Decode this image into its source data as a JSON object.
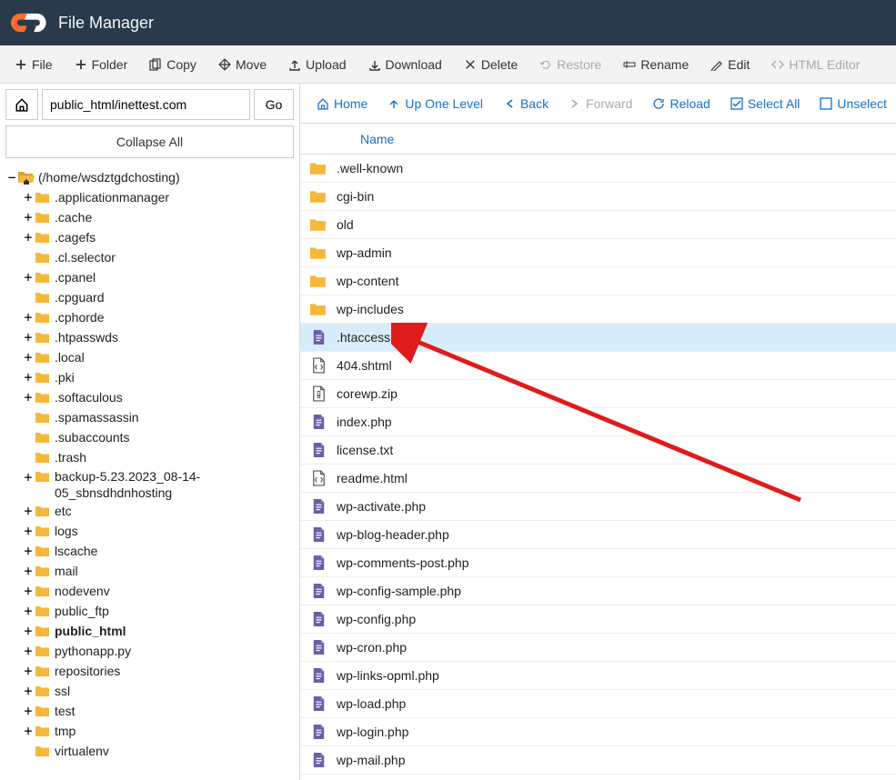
{
  "header": {
    "title": "File Manager"
  },
  "toolbar": {
    "file": "File",
    "folder": "Folder",
    "copy": "Copy",
    "move": "Move",
    "upload": "Upload",
    "download": "Download",
    "delete": "Delete",
    "restore": "Restore",
    "rename": "Rename",
    "edit": "Edit",
    "html_editor": "HTML Editor"
  },
  "path_bar": {
    "path": "public_html/inettest.com",
    "go": "Go"
  },
  "collapse": "Collapse All",
  "tree": {
    "root": "(/home/wsdztgdchosting)",
    "items": [
      {
        "label": ".applicationmanager",
        "expandable": true
      },
      {
        "label": ".cache",
        "expandable": true
      },
      {
        "label": ".cagefs",
        "expandable": true
      },
      {
        "label": ".cl.selector",
        "expandable": false
      },
      {
        "label": ".cpanel",
        "expandable": true
      },
      {
        "label": ".cpguard",
        "expandable": false
      },
      {
        "label": ".cphorde",
        "expandable": true
      },
      {
        "label": ".htpasswds",
        "expandable": true
      },
      {
        "label": ".local",
        "expandable": true
      },
      {
        "label": ".pki",
        "expandable": true
      },
      {
        "label": ".softaculous",
        "expandable": true
      },
      {
        "label": ".spamassassin",
        "expandable": false
      },
      {
        "label": ".subaccounts",
        "expandable": false
      },
      {
        "label": ".trash",
        "expandable": false
      },
      {
        "label": "backup-5.23.2023_08-14-05_sbnsdhdnhosting",
        "expandable": true,
        "wrap": true
      },
      {
        "label": "etc",
        "expandable": true
      },
      {
        "label": "logs",
        "expandable": true
      },
      {
        "label": "lscache",
        "expandable": true
      },
      {
        "label": "mail",
        "expandable": true
      },
      {
        "label": "nodevenv",
        "expandable": true
      },
      {
        "label": "public_ftp",
        "expandable": true
      },
      {
        "label": "public_html",
        "expandable": true,
        "bold": true
      },
      {
        "label": "pythonapp.py",
        "expandable": true
      },
      {
        "label": "repositories",
        "expandable": true
      },
      {
        "label": "ssl",
        "expandable": true
      },
      {
        "label": "test",
        "expandable": true
      },
      {
        "label": "tmp",
        "expandable": true
      },
      {
        "label": "virtualenv",
        "expandable": false
      }
    ]
  },
  "actions": {
    "home": "Home",
    "up": "Up One Level",
    "back": "Back",
    "forward": "Forward",
    "reload": "Reload",
    "select_all": "Select All",
    "unselect": "Unselect"
  },
  "table": {
    "name_header": "Name"
  },
  "files": [
    {
      "name": ".well-known",
      "type": "folder"
    },
    {
      "name": "cgi-bin",
      "type": "folder"
    },
    {
      "name": "old",
      "type": "folder"
    },
    {
      "name": "wp-admin",
      "type": "folder"
    },
    {
      "name": "wp-content",
      "type": "folder"
    },
    {
      "name": "wp-includes",
      "type": "folder"
    },
    {
      "name": ".htaccess",
      "type": "file",
      "selected": true
    },
    {
      "name": "404.shtml",
      "type": "html"
    },
    {
      "name": "corewp.zip",
      "type": "zip"
    },
    {
      "name": "index.php",
      "type": "file"
    },
    {
      "name": "license.txt",
      "type": "file"
    },
    {
      "name": "readme.html",
      "type": "html"
    },
    {
      "name": "wp-activate.php",
      "type": "file"
    },
    {
      "name": "wp-blog-header.php",
      "type": "file"
    },
    {
      "name": "wp-comments-post.php",
      "type": "file"
    },
    {
      "name": "wp-config-sample.php",
      "type": "file"
    },
    {
      "name": "wp-config.php",
      "type": "file"
    },
    {
      "name": "wp-cron.php",
      "type": "file"
    },
    {
      "name": "wp-links-opml.php",
      "type": "file"
    },
    {
      "name": "wp-load.php",
      "type": "file"
    },
    {
      "name": "wp-login.php",
      "type": "file"
    },
    {
      "name": "wp-mail.php",
      "type": "file"
    }
  ]
}
